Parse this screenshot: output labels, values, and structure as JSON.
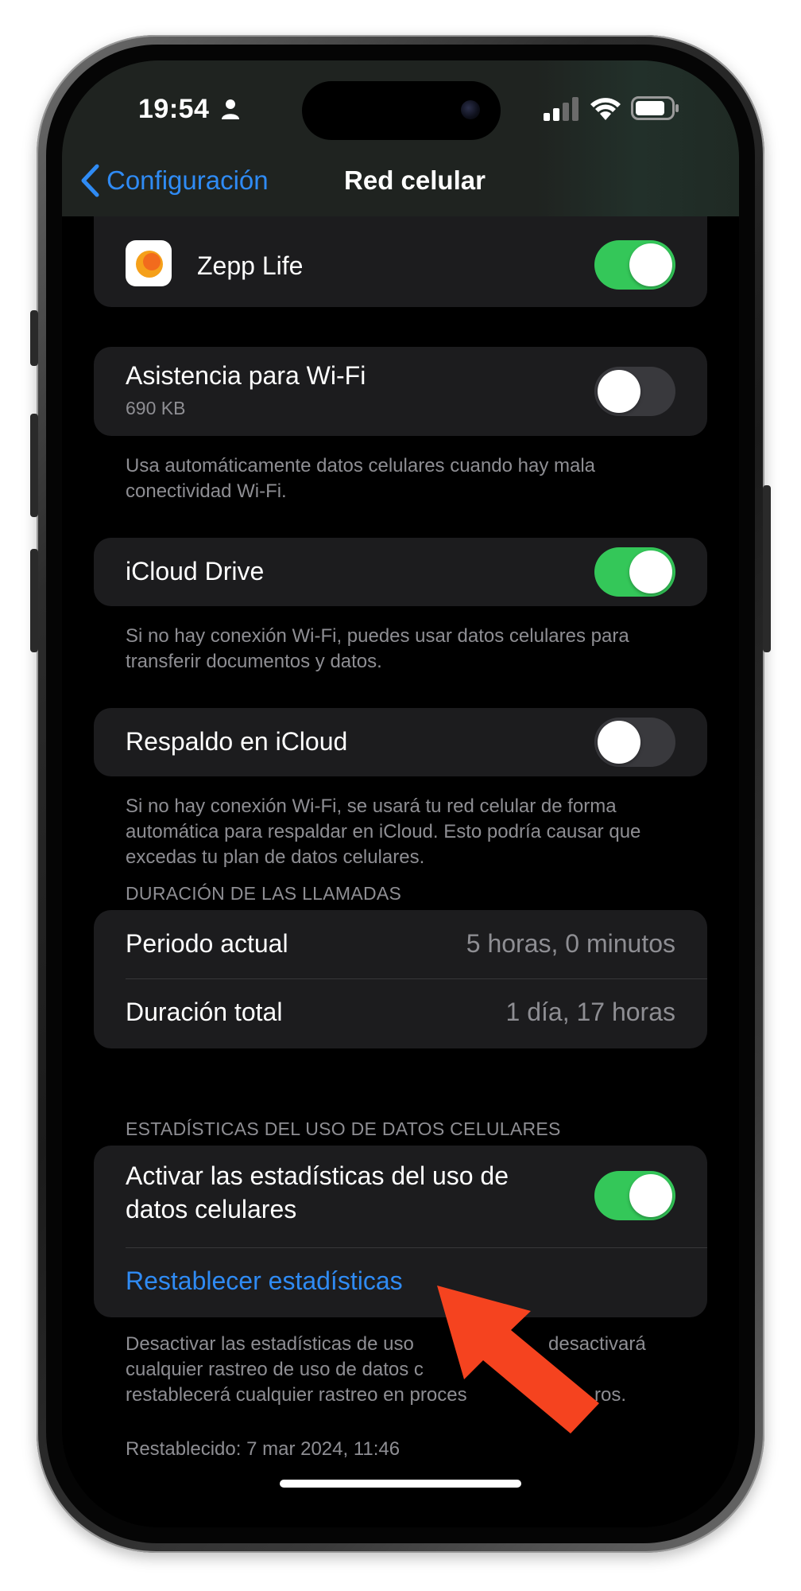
{
  "status_bar": {
    "time": "19:54",
    "person_icon": "person-icon",
    "signal_icon": "cellular-signal-icon",
    "wifi_icon": "wifi-icon",
    "battery_icon": "battery-icon"
  },
  "nav": {
    "back_label": "Configuración",
    "title": "Red celular"
  },
  "apps": [
    {
      "name": "Zepp Life",
      "enabled": true,
      "icon": "zepp-life-icon"
    }
  ],
  "wifi_assist": {
    "title": "Asistencia para Wi-Fi",
    "usage": "690 KB",
    "enabled": false,
    "footnote": "Usa automáticamente datos celulares cuando hay mala conectividad Wi-Fi."
  },
  "icloud_drive": {
    "title": "iCloud Drive",
    "enabled": true,
    "footnote": "Si no hay conexión Wi-Fi, puedes usar datos celulares para transferir documentos y datos."
  },
  "icloud_backup": {
    "title": "Respaldo en iCloud",
    "enabled": false,
    "footnote": "Si no hay conexión Wi-Fi, se usará tu red celular de forma automática para respaldar en iCloud. Esto podría causar que excedas tu plan de datos celulares."
  },
  "call_duration": {
    "header": "DURACIÓN DE LAS LLAMADAS",
    "rows": [
      {
        "label": "Periodo actual",
        "value": "5 horas, 0 minutos"
      },
      {
        "label": "Duración total",
        "value": "1 día, 17 horas"
      }
    ]
  },
  "stats": {
    "header": "ESTADÍSTICAS DEL USO DE DATOS CELULARES",
    "toggle_title_line1": "Activar las estadísticas del uso de",
    "toggle_title_line2": "datos celulares",
    "enabled": true,
    "reset_link": "Restablecer estadísticas",
    "footnote_line1": "Desactivar las estadísticas de uso",
    "footnote_line1_end": "desactivará",
    "footnote_line2": "cualquier rastreo de uso de datos c",
    "footnote_line3": "restablecerá cualquier rastreo en proces",
    "footnote_line3_end": "ros.",
    "reset_date": "Restablecido: 7 mar 2024, 11:46"
  },
  "colors": {
    "accent_blue": "#2f8bf4",
    "toggle_on": "#34c759",
    "toggle_off": "#39393d",
    "card_bg": "#1c1c1e",
    "annotation_arrow": "#f5431f"
  }
}
